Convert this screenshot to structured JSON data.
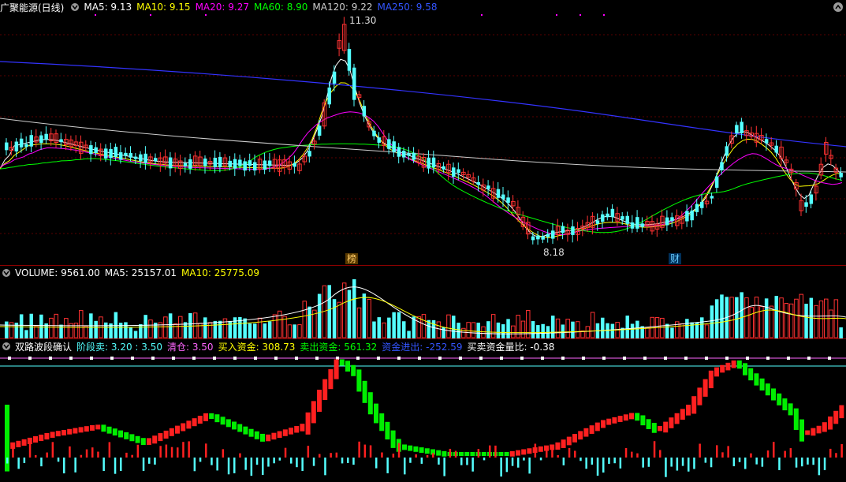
{
  "main": {
    "title": "广聚能源(日线)",
    "ma5": "MA5: 9.13",
    "ma10": "MA10: 9.15",
    "ma20": "MA20: 9.27",
    "ma60": "MA60: 8.90",
    "ma120": "MA120: 9.22",
    "ma250": "MA250: 9.58",
    "high_label": "11.30",
    "low_label": "8.18",
    "tag1": "榜",
    "tag2": "财"
  },
  "volume": {
    "label": "VOLUME: 9561.00",
    "ma5": "MA5: 25157.01",
    "ma10": "MA10: 25775.09"
  },
  "indicator": {
    "name": "双路波段确认",
    "stage_sell": "阶段卖: 3.20 : 3.50",
    "clear": "清仓: 3.50",
    "buy_funds": "买入资金: 308.73",
    "sell_funds": "卖出资金: 561.32",
    "net_funds": "资金进出: -252.59",
    "ratio": "买卖资金量比: -0.38"
  },
  "colors": {
    "up": "#ff3232",
    "down": "#54ffff",
    "ma5": "#ffffff",
    "ma10": "#ffff00",
    "ma20": "#ff00ff",
    "ma60": "#00ff00",
    "ma120": "#cccccc",
    "ma250": "#3333ff"
  }
}
